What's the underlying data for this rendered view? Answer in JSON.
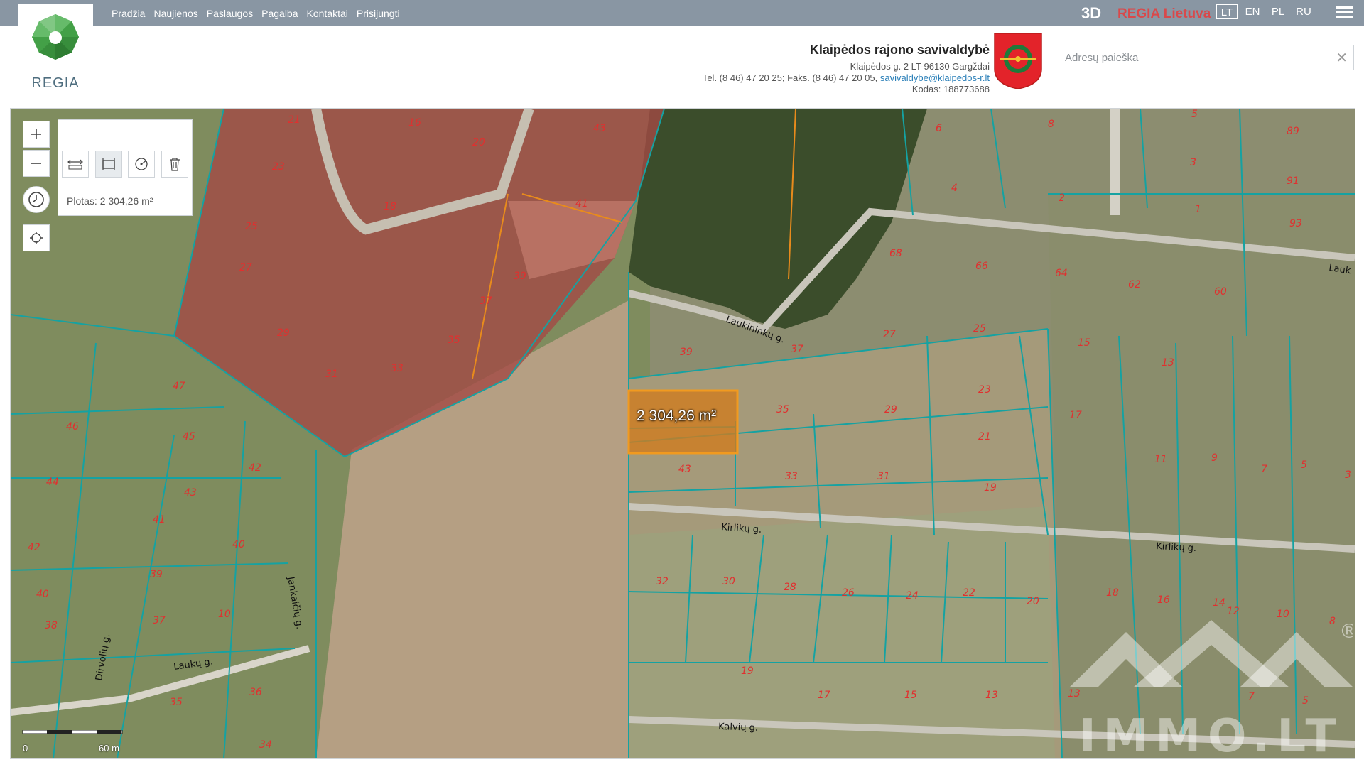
{
  "nav": {
    "items": [
      {
        "label": "Pradžia"
      },
      {
        "label": "Naujienos"
      },
      {
        "label": "Paslaugos"
      },
      {
        "label": "Pagalba"
      },
      {
        "label": "Kontaktai"
      },
      {
        "label": "Prisijungti"
      }
    ]
  },
  "logo": {
    "text": "REGIA"
  },
  "topbar": {
    "view_3d": "3D",
    "regia_lietuva": "REGIA Lietuva",
    "languages": [
      {
        "code": "LT",
        "active": true
      },
      {
        "code": "EN",
        "active": false
      },
      {
        "code": "PL",
        "active": false
      },
      {
        "code": "RU",
        "active": false
      }
    ],
    "menu_icon": "hamburger-icon"
  },
  "municipality": {
    "name": "Klaipėdos rajono savivaldybė",
    "address": "Klaipėdos g. 2 LT-96130 Gargždai",
    "phone": "Tel. (8 46) 47 20 25; Faks. (8 46) 47 20 05,",
    "email": "savivaldybe@klaipedos-r.lt",
    "code": "Kodas: 188773688"
  },
  "search": {
    "placeholder": "Adresų paieška",
    "value": "",
    "clear": "✕"
  },
  "map": {
    "measure_readout": "Plotas: 2 304,26 m²",
    "measure_label": "2 304,26 m²",
    "scale_zero": "0",
    "scale_length": "60 m",
    "parcels": [
      "21",
      "16",
      "20",
      "43",
      "23",
      "18",
      "25",
      "41",
      "27",
      "39",
      "37",
      "29",
      "31",
      "33",
      "35",
      "47",
      "46",
      "45",
      "44",
      "42",
      "43",
      "41",
      "42",
      "40",
      "39",
      "40",
      "38",
      "37",
      "10",
      "35",
      "36",
      "34",
      "6",
      "8",
      "5",
      "89",
      "3",
      "91",
      "4",
      "2",
      "1",
      "93",
      "68",
      "66",
      "64",
      "62",
      "60",
      "27",
      "25",
      "15",
      "13",
      "39",
      "37",
      "35",
      "29",
      "23",
      "21",
      "17",
      "43",
      "33",
      "31",
      "19",
      "11",
      "9",
      "7",
      "5",
      "3",
      "32",
      "30",
      "28",
      "26",
      "24",
      "22",
      "20",
      "18",
      "16",
      "14",
      "12",
      "10",
      "8",
      "19",
      "17",
      "15",
      "13",
      "13",
      "7",
      "5"
    ],
    "roads": [
      "Laukininkų g.",
      "Kirlikų g.",
      "Kirlikų g.",
      "Kalvių g.",
      "Laukų g.",
      "Dirvolių g.",
      "Jankaičių g.",
      "Lauk"
    ]
  },
  "watermark": {
    "text": "IMMO.LT",
    "registered": "®"
  },
  "colors": {
    "topbar": "#8996a3",
    "accent_red": "#d9494b",
    "parcel_line": "#15a2a2",
    "measure_fill": "#e0861e",
    "link": "#2a7fb8"
  }
}
